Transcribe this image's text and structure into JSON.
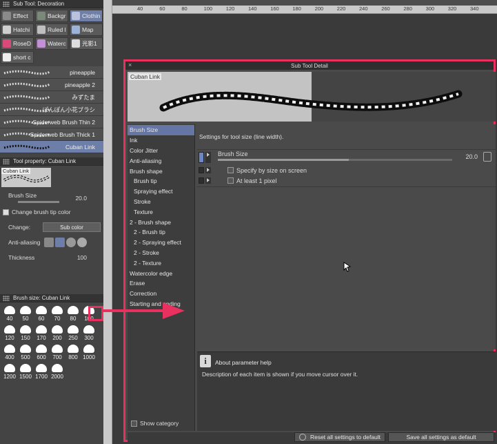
{
  "left_panel": {
    "subtool_title": "Sub Tool: Decoration",
    "groups": [
      {
        "label": "Effect",
        "icon": "effect-icon",
        "selected": false
      },
      {
        "label": "Backgr",
        "icon": "grass-icon",
        "selected": false
      },
      {
        "label": "Clothin",
        "icon": "clothing-icon",
        "selected": true
      },
      {
        "label": "Hatchi",
        "icon": "hatching-icon",
        "selected": false
      },
      {
        "label": "Ruled l",
        "icon": "ruled-line-icon",
        "selected": false
      },
      {
        "label": "Map",
        "icon": "map-icon",
        "selected": false
      },
      {
        "label": "RoseD",
        "icon": "rose-icon",
        "selected": false
      },
      {
        "label": "Waterc",
        "icon": "watercolor-icon",
        "selected": false
      },
      {
        "label": "光影1",
        "icon": "pen-icon",
        "selected": false
      },
      {
        "label": "short c",
        "icon": "feather-icon",
        "selected": false
      }
    ],
    "brushes": [
      {
        "label": "pineapple",
        "selected": false
      },
      {
        "label": "pineapple 2",
        "selected": false
      },
      {
        "label": "みずたま",
        "selected": false
      },
      {
        "label": "ぽんぽん小花ブラシ",
        "selected": false
      },
      {
        "label": "Spiderweb Brush Thin 2",
        "selected": false
      },
      {
        "label": "Spiderweb Brush Thick 1",
        "selected": false
      },
      {
        "label": "Cuban Link",
        "selected": true
      }
    ],
    "tool_property": {
      "title": "Tool property: Cuban Link",
      "preview_label": "Cuban Link",
      "brush_size_label": "Brush Size",
      "brush_size_value": "20.0",
      "change_tip_color_label": "Change brush tip color",
      "change_label": "Change:",
      "change_value": "Sub color",
      "antialiasing_label": "Anti-aliasing",
      "thickness_label": "Thickness",
      "thickness_value": "100"
    },
    "brush_size_palette": {
      "title": "Brush size: Cuban Link",
      "sizes": [
        "40",
        "50",
        "60",
        "70",
        "80",
        "100",
        "120",
        "150",
        "170",
        "200",
        "250",
        "300",
        "400",
        "500",
        "600",
        "700",
        "800",
        "1000",
        "1200",
        "1500",
        "1700",
        "2000"
      ]
    }
  },
  "ruler": {
    "labels": [
      "40",
      "60",
      "80",
      "100",
      "120",
      "140",
      "160",
      "180",
      "200",
      "220",
      "240",
      "260",
      "280",
      "300",
      "320",
      "340"
    ]
  },
  "dialog": {
    "title": "Sub Tool Detail",
    "close_label": "×",
    "preview_label": "Cuban Link",
    "categories": [
      {
        "label": "Brush Size",
        "sub": false,
        "selected": true
      },
      {
        "label": "Ink",
        "sub": false,
        "selected": false
      },
      {
        "label": "Color Jitter",
        "sub": false,
        "selected": false
      },
      {
        "label": "Anti-aliasing",
        "sub": false,
        "selected": false
      },
      {
        "label": "Brush shape",
        "sub": false,
        "selected": false
      },
      {
        "label": "Brush tip",
        "sub": true,
        "selected": false
      },
      {
        "label": "Spraying effect",
        "sub": true,
        "selected": false
      },
      {
        "label": "Stroke",
        "sub": true,
        "selected": false
      },
      {
        "label": "Texture",
        "sub": true,
        "selected": false
      },
      {
        "label": "2 - Brush shape",
        "sub": false,
        "selected": false
      },
      {
        "label": "2 - Brush tip",
        "sub": true,
        "selected": false
      },
      {
        "label": "2 - Spraying effect",
        "sub": true,
        "selected": false
      },
      {
        "label": "2 - Stroke",
        "sub": true,
        "selected": false
      },
      {
        "label": "2 - Texture",
        "sub": true,
        "selected": false
      },
      {
        "label": "Watercolor edge",
        "sub": false,
        "selected": false
      },
      {
        "label": "Erase",
        "sub": false,
        "selected": false
      },
      {
        "label": "Correction",
        "sub": false,
        "selected": false
      },
      {
        "label": "Starting and ending",
        "sub": false,
        "selected": false
      }
    ],
    "show_category_label": "Show category",
    "settings_hint": "Settings for tool size (line width).",
    "brush_size_label": "Brush Size",
    "brush_size_value": "20.0",
    "specify_by_size_label": "Specify by size on screen",
    "at_least_label": "At least 1 pixel",
    "about_title": "About parameter help",
    "about_desc": "Description of each item is shown if you move cursor over it.",
    "reset_label": "Reset all settings to default",
    "save_label": "Save all settings as default"
  },
  "colors": {
    "highlight": "#e8315e",
    "selection": "#6676a4",
    "panel": "#444444"
  }
}
